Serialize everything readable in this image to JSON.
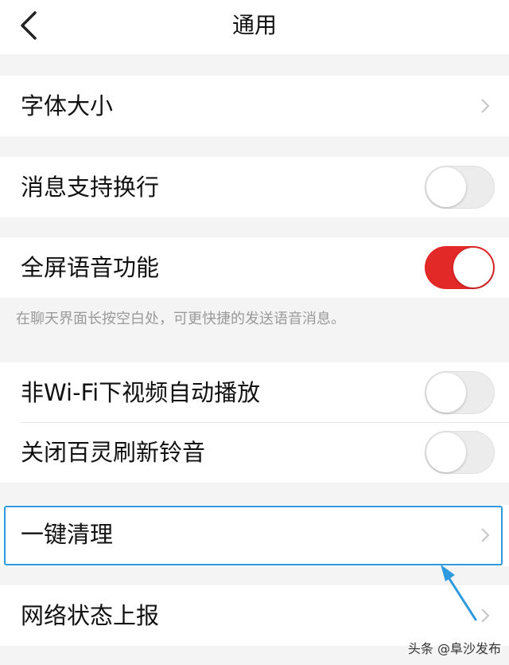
{
  "header": {
    "title": "通用",
    "back_icon": "chevron-left-icon"
  },
  "settings": {
    "font_size": {
      "label": "字体大小",
      "type": "link"
    },
    "message_wrap": {
      "label": "消息支持换行",
      "type": "toggle",
      "on": false
    },
    "fullscreen_voice": {
      "label": "全屏语音功能",
      "type": "toggle",
      "on": true,
      "hint": "在聊天界面长按空白处，可更快捷的发送语音消息。"
    },
    "wifi_autoplay": {
      "label": "非Wi-Fi下视频自动播放",
      "type": "toggle",
      "on": false
    },
    "refresh_ringtone": {
      "label": "关闭百灵刷新铃音",
      "type": "toggle",
      "on": false
    },
    "one_click_clean": {
      "label": "一键清理",
      "type": "link"
    },
    "network_report": {
      "label": "网络状态上报",
      "type": "link"
    }
  },
  "annotation": {
    "highlight_color": "#2d9ae0"
  },
  "colors": {
    "toggle_on": "#e32828",
    "toggle_off": "#ececec",
    "background": "#f4f4f4"
  },
  "watermark": "头条 @阜沙发布"
}
